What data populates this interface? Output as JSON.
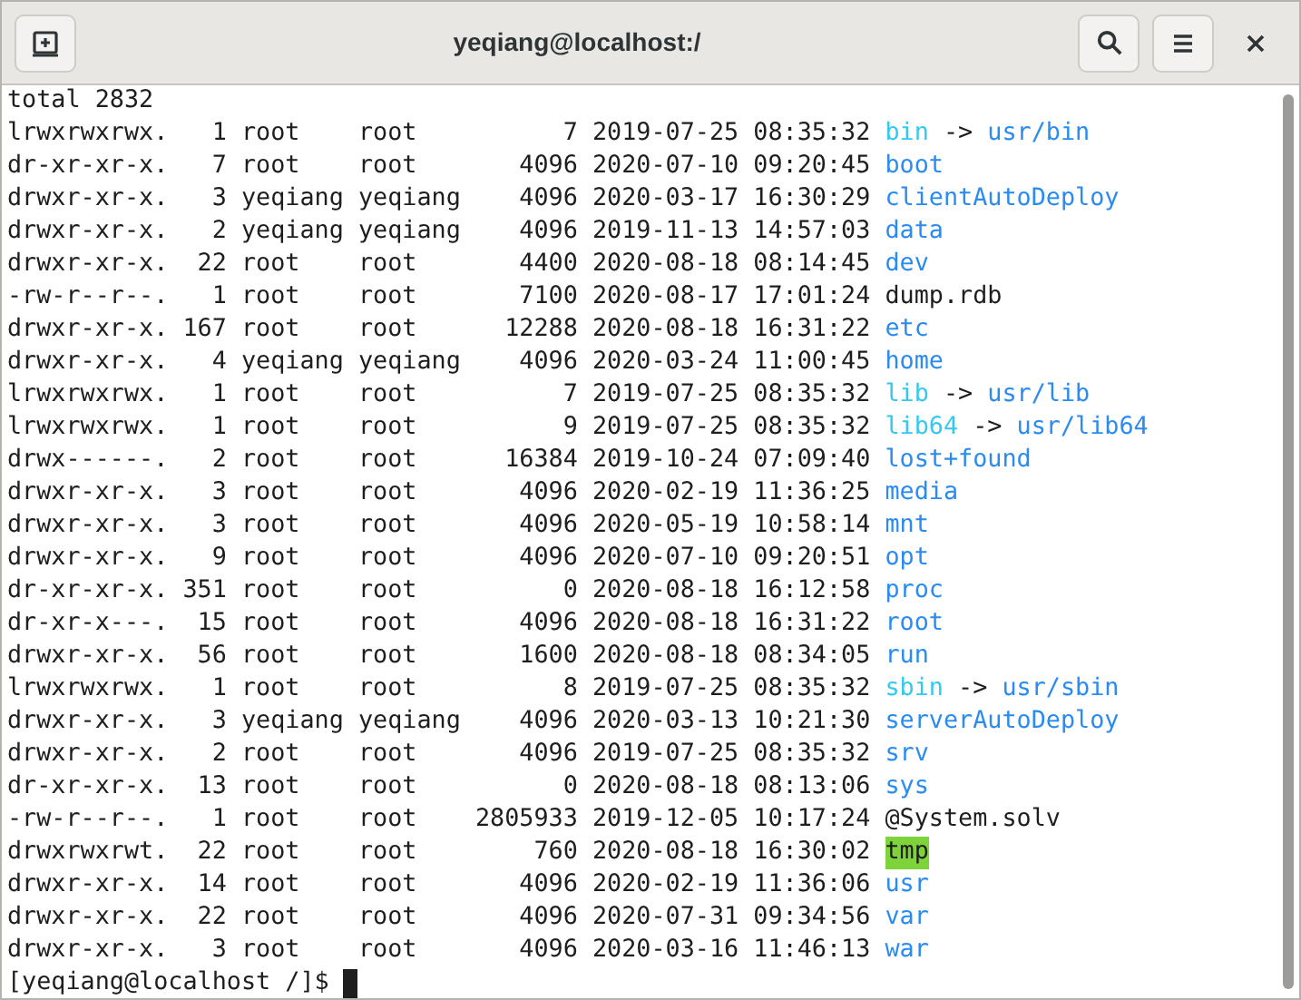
{
  "window": {
    "title": "yeqiang@localhost:/"
  },
  "terminal": {
    "header": "total 2832",
    "lines": [
      {
        "info": "lrwxrwxrwx.   1 root    root          7 2019-07-25 08:35:32",
        "name": "bin",
        "kind": "link",
        "arrow": "->",
        "target": "usr/bin"
      },
      {
        "info": "dr-xr-xr-x.   7 root    root       4096 2020-07-10 09:20:45",
        "name": "boot",
        "kind": "dir"
      },
      {
        "info": "drwxr-xr-x.   3 yeqiang yeqiang    4096 2020-03-17 16:30:29",
        "name": "clientAutoDeploy",
        "kind": "dir"
      },
      {
        "info": "drwxr-xr-x.   2 yeqiang yeqiang    4096 2019-11-13 14:57:03",
        "name": "data",
        "kind": "dir"
      },
      {
        "info": "drwxr-xr-x.  22 root    root       4400 2020-08-18 08:14:45",
        "name": "dev",
        "kind": "dir"
      },
      {
        "info": "-rw-r--r--.   1 root    root       7100 2020-08-17 17:01:24",
        "name": "dump.rdb",
        "kind": "file"
      },
      {
        "info": "drwxr-xr-x. 167 root    root      12288 2020-08-18 16:31:22",
        "name": "etc",
        "kind": "dir"
      },
      {
        "info": "drwxr-xr-x.   4 yeqiang yeqiang    4096 2020-03-24 11:00:45",
        "name": "home",
        "kind": "dir"
      },
      {
        "info": "lrwxrwxrwx.   1 root    root          7 2019-07-25 08:35:32",
        "name": "lib",
        "kind": "link",
        "arrow": "->",
        "target": "usr/lib"
      },
      {
        "info": "lrwxrwxrwx.   1 root    root          9 2019-07-25 08:35:32",
        "name": "lib64",
        "kind": "link",
        "arrow": "->",
        "target": "usr/lib64"
      },
      {
        "info": "drwx------.   2 root    root      16384 2019-10-24 07:09:40",
        "name": "lost+found",
        "kind": "dir"
      },
      {
        "info": "drwxr-xr-x.   3 root    root       4096 2020-02-19 11:36:25",
        "name": "media",
        "kind": "dir"
      },
      {
        "info": "drwxr-xr-x.   3 root    root       4096 2020-05-19 10:58:14",
        "name": "mnt",
        "kind": "dir"
      },
      {
        "info": "drwxr-xr-x.   9 root    root       4096 2020-07-10 09:20:51",
        "name": "opt",
        "kind": "dir"
      },
      {
        "info": "dr-xr-xr-x. 351 root    root          0 2020-08-18 16:12:58",
        "name": "proc",
        "kind": "dir"
      },
      {
        "info": "dr-xr-x---.  15 root    root       4096 2020-08-18 16:31:22",
        "name": "root",
        "kind": "dir"
      },
      {
        "info": "drwxr-xr-x.  56 root    root       1600 2020-08-18 08:34:05",
        "name": "run",
        "kind": "dir"
      },
      {
        "info": "lrwxrwxrwx.   1 root    root          8 2019-07-25 08:35:32",
        "name": "sbin",
        "kind": "link",
        "arrow": "->",
        "target": "usr/sbin"
      },
      {
        "info": "drwxr-xr-x.   3 yeqiang yeqiang    4096 2020-03-13 10:21:30",
        "name": "serverAutoDeploy",
        "kind": "dir"
      },
      {
        "info": "drwxr-xr-x.   2 root    root       4096 2019-07-25 08:35:32",
        "name": "srv",
        "kind": "dir"
      },
      {
        "info": "dr-xr-xr-x.  13 root    root          0 2020-08-18 08:13:06",
        "name": "sys",
        "kind": "dir"
      },
      {
        "info": "-rw-r--r--.   1 root    root    2805933 2019-12-05 10:17:24",
        "name": "@System.solv",
        "kind": "file"
      },
      {
        "info": "drwxrwxrwt.  22 root    root        760 2020-08-18 16:30:02",
        "name": "tmp",
        "kind": "sticky"
      },
      {
        "info": "drwxr-xr-x.  14 root    root       4096 2020-02-19 11:36:06",
        "name": "usr",
        "kind": "dir"
      },
      {
        "info": "drwxr-xr-x.  22 root    root       4096 2020-07-31 09:34:56",
        "name": "var",
        "kind": "dir"
      },
      {
        "info": "drwxr-xr-x.   3 root    root       4096 2020-03-16 11:46:13",
        "name": "war",
        "kind": "dir"
      }
    ],
    "prompt": "[yeqiang@localhost /]$"
  }
}
